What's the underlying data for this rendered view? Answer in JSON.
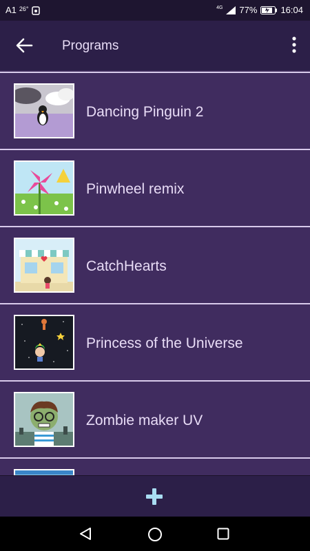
{
  "status": {
    "carrier": "A1",
    "temperature": "26°",
    "network": "4G",
    "battery": "77%",
    "time": "16:04"
  },
  "app_bar": {
    "title": "Programs"
  },
  "programs": [
    {
      "name": "Dancing Pinguin 2",
      "thumb_icon": "penguin-scene-icon"
    },
    {
      "name": "Pinwheel remix",
      "thumb_icon": "pinwheel-scene-icon"
    },
    {
      "name": "CatchHearts",
      "thumb_icon": "shop-scene-icon"
    },
    {
      "name": "Princess of the Universe",
      "thumb_icon": "space-scene-icon"
    },
    {
      "name": "Zombie maker UV",
      "thumb_icon": "zombie-scene-icon"
    }
  ],
  "colors": {
    "background": "#3d2a5a",
    "app_bar": "#2c1f48",
    "text": "#e8dcf6",
    "accent": "#a9dcf2"
  }
}
